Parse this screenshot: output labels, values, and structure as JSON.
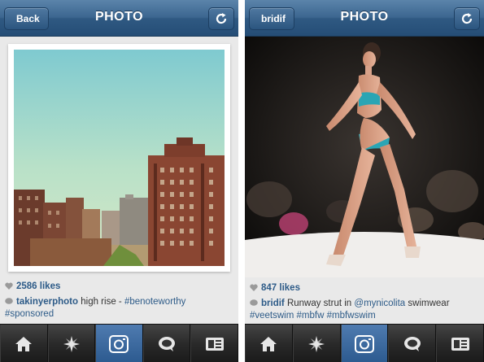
{
  "left": {
    "nav": {
      "title": "PHOTO",
      "back_label": "Back",
      "refresh_icon": "refresh-icon"
    },
    "post": {
      "likes": "2586 likes",
      "username": "takinyerphoto",
      "caption": " high rise - ",
      "tags": [
        "#benoteworthy",
        "#sponsored"
      ]
    }
  },
  "right": {
    "nav": {
      "title": "PHOTO",
      "back_label": "bridif",
      "refresh_icon": "refresh-icon"
    },
    "post": {
      "likes": "847 likes",
      "username": "bridif",
      "caption_a": " Runway strut in ",
      "mention": "@mynicolita",
      "caption_b": " swimwear",
      "tags": [
        "#veetswim",
        "#mbfw",
        "#mbfwswim"
      ]
    }
  },
  "tabbar": {
    "items": [
      {
        "icon": "home-icon",
        "active": false
      },
      {
        "icon": "explore-icon",
        "active": false
      },
      {
        "icon": "camera-icon",
        "active": true
      },
      {
        "icon": "news-icon",
        "active": false
      },
      {
        "icon": "profile-icon",
        "active": false
      }
    ]
  },
  "colors": {
    "nav_blue": "#2f5982",
    "link_blue": "#2d5b88",
    "tab_active": "#3a6aa0"
  }
}
